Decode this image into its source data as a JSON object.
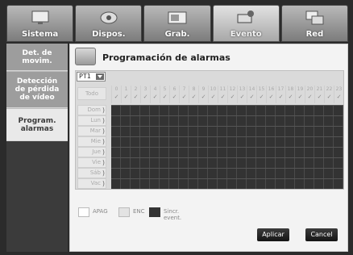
{
  "top_tabs": [
    {
      "label": "Sistema",
      "icon": "monitor-icon",
      "active": false
    },
    {
      "label": "Dispos.",
      "icon": "camera-icon",
      "active": false
    },
    {
      "label": "Grab.",
      "icon": "recorder-icon",
      "active": false
    },
    {
      "label": "Evento",
      "icon": "event-camera-icon",
      "active": true
    },
    {
      "label": "Red",
      "icon": "network-icon",
      "active": false
    }
  ],
  "sidebar": {
    "items": [
      {
        "label": "Det. de movim.",
        "active": false
      },
      {
        "label": "Detección de pérdida de vídeo",
        "active": false
      },
      {
        "label": "Program. alarmas",
        "active": true
      }
    ]
  },
  "main": {
    "title": "Programación de alarmas",
    "channel_select": {
      "value": "PT1"
    },
    "all_label": "Todo",
    "hours": [
      "0",
      "1",
      "2",
      "3",
      "4",
      "5",
      "6",
      "7",
      "8",
      "9",
      "10",
      "11",
      "12",
      "13",
      "14",
      "15",
      "16",
      "17",
      "18",
      "19",
      "20",
      "21",
      "22",
      "23"
    ],
    "check_mark": "✓",
    "days": [
      "Dom",
      "Lun",
      "Mar",
      "Mie",
      "Jue",
      "Vie",
      "Sáb",
      "Vac"
    ],
    "legend": [
      {
        "label": "APAG",
        "color": "#ffffff"
      },
      {
        "label": "ENC",
        "color": "#e3e3e3"
      },
      {
        "label": "Sincr. event.",
        "color": "#333333"
      }
    ],
    "buttons": {
      "apply": "Aplicar",
      "cancel": "Cancel"
    }
  },
  "colors": {
    "grid_active": "#333333",
    "panel_bg": "#f3f3f3"
  }
}
